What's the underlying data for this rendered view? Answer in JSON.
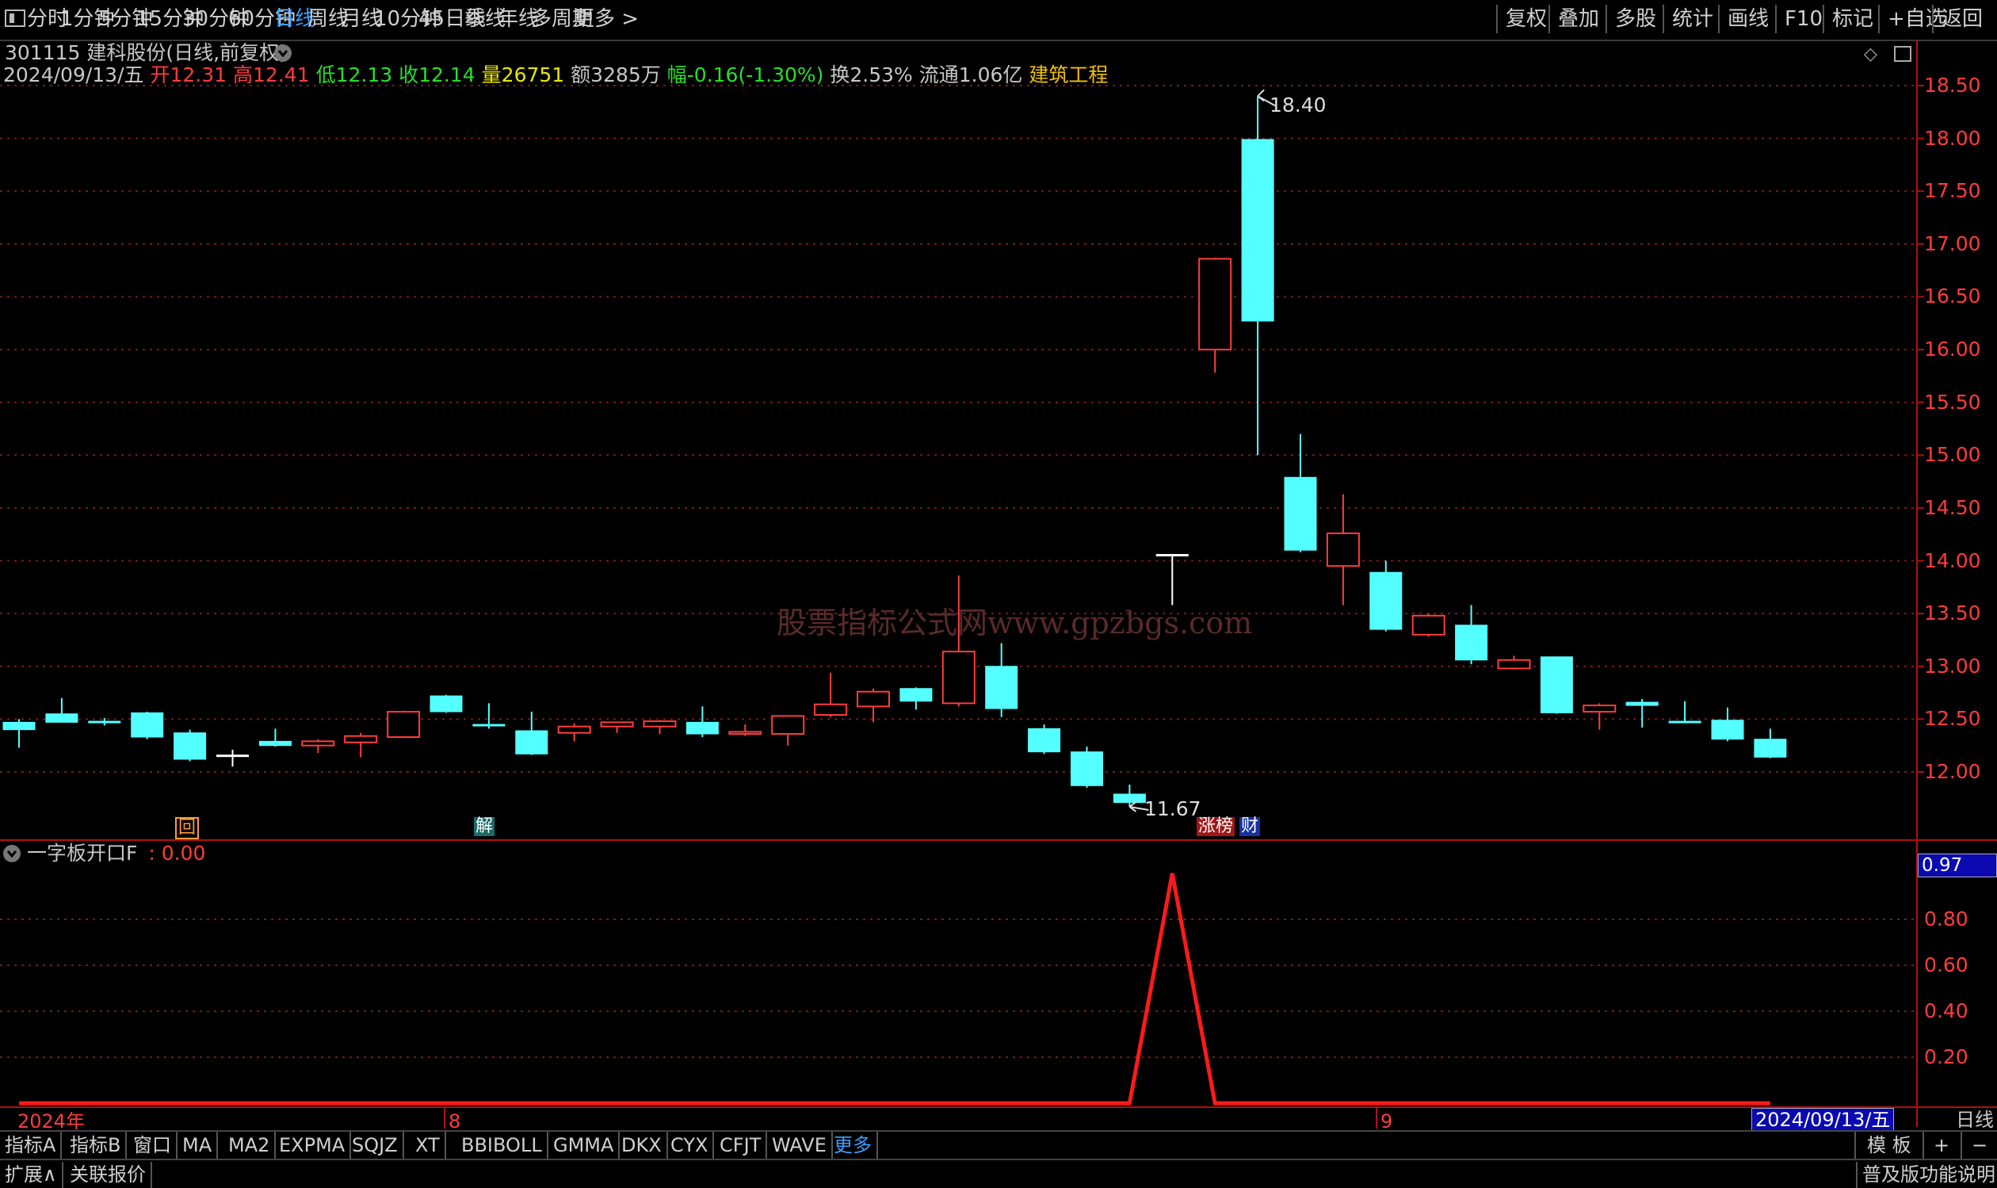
{
  "toolbar": {
    "periods": [
      {
        "label": "分时",
        "active": false
      },
      {
        "label": "1分钟",
        "active": false
      },
      {
        "label": "5分钟",
        "active": false
      },
      {
        "label": "15分钟",
        "active": false
      },
      {
        "label": "30分钟",
        "active": false
      },
      {
        "label": "60分钟",
        "active": false
      },
      {
        "label": "日线",
        "active": true
      },
      {
        "label": "周线",
        "active": false
      },
      {
        "label": "月线",
        "active": false
      },
      {
        "label": "10分钟",
        "active": false
      },
      {
        "label": "45日线",
        "active": false
      },
      {
        "label": "季线",
        "active": false
      },
      {
        "label": "年线",
        "active": false
      },
      {
        "label": "多周期",
        "active": false
      },
      {
        "label": "更多 >",
        "active": false
      }
    ],
    "right_buttons": [
      "复权",
      "叠加",
      "多股",
      "统计",
      "画线",
      "F10",
      "标记",
      "+自选",
      "返回"
    ]
  },
  "stock": {
    "title": "301115 建科股份(日线,前复权)",
    "date": "2024/09/13/五",
    "open_label": "开",
    "open": "12.31",
    "high_label": "高",
    "high": "12.41",
    "low_label": "低",
    "low": "12.13",
    "close_label": "收",
    "close": "12.14",
    "volume_label": "量",
    "volume": "26751",
    "amount_label": "额",
    "amount": "3285万",
    "change_label": "幅",
    "change": "-0.16(-1.30%)",
    "turnover": "换2.53%",
    "float": "流通1.06亿",
    "sector": "建筑工程"
  },
  "price_axis": [
    "18.50",
    "18.00",
    "17.50",
    "17.00",
    "16.50",
    "16.00",
    "15.50",
    "15.00",
    "14.50",
    "14.00",
    "13.50",
    "13.00",
    "12.50",
    "12.00"
  ],
  "indicator": {
    "name": "一字板开口F",
    "value": ": 0.00",
    "axis": [
      "0.80",
      "0.60",
      "0.40",
      "0.20"
    ],
    "current": "0.97"
  },
  "annotations": {
    "high_label": "18.40",
    "low_label": "11.67",
    "marker_hui": "回",
    "marker_jie": "解",
    "marker_zhangbang": "涨榜",
    "marker_cai": "财"
  },
  "date_axis": {
    "start": "2024年",
    "m8": "8",
    "m9": "9",
    "current_date": "2024/09/13/五",
    "period": "日线"
  },
  "watermark": "股票指标公式网www.gpzbgs.com",
  "bottom_tabs": [
    {
      "label": "指标A",
      "active": false
    },
    {
      "label": "指标B",
      "active": false
    },
    {
      "label": "窗口",
      "active": false
    },
    {
      "label": "MA",
      "active": false
    },
    {
      "label": "MA2",
      "active": false
    },
    {
      "label": "EXPMA",
      "active": false
    },
    {
      "label": "SQJZ",
      "active": false
    },
    {
      "label": "XT",
      "active": false
    },
    {
      "label": "BBIBOLL",
      "active": false
    },
    {
      "label": "GMMA",
      "active": false
    },
    {
      "label": "DKX",
      "active": false
    },
    {
      "label": "CYX",
      "active": false
    },
    {
      "label": "CFJT",
      "active": false
    },
    {
      "label": "WAVE",
      "active": false
    },
    {
      "label": "更多",
      "active": true
    }
  ],
  "bottom_right": {
    "template": "模 板",
    "plus": "+",
    "minus": "−"
  },
  "status": {
    "expand": "扩展∧",
    "related": "关联报价",
    "edition": "普及版功能说明"
  },
  "colors": {
    "up": "#ff3c3c",
    "down": "#54ffff",
    "doji": "#ffffff",
    "grid": "#7a1a1a",
    "indicator_line": "#ff1a1a"
  },
  "chart_data": {
    "type": "candlestick",
    "symbol": "301115 建科股份",
    "y_range": [
      11.5,
      18.6
    ],
    "candles": [
      {
        "o": 12.47,
        "h": 12.5,
        "l": 12.23,
        "c": 12.4
      },
      {
        "o": 12.55,
        "h": 12.7,
        "l": 12.48,
        "c": 12.47
      },
      {
        "o": 12.48,
        "h": 12.51,
        "l": 12.44,
        "c": 12.47
      },
      {
        "o": 12.56,
        "h": 12.57,
        "l": 12.31,
        "c": 12.33
      },
      {
        "o": 12.37,
        "h": 12.4,
        "l": 12.1,
        "c": 12.12
      },
      {
        "o": 12.16,
        "h": 12.21,
        "l": 12.05,
        "c": 12.16
      },
      {
        "o": 12.29,
        "h": 12.41,
        "l": 12.24,
        "c": 12.25
      },
      {
        "o": 12.25,
        "h": 12.31,
        "l": 12.18,
        "c": 12.29
      },
      {
        "o": 12.28,
        "h": 12.37,
        "l": 12.14,
        "c": 12.34
      },
      {
        "o": 12.33,
        "h": 12.58,
        "l": 12.32,
        "c": 12.57
      },
      {
        "o": 12.72,
        "h": 12.73,
        "l": 12.56,
        "c": 12.57
      },
      {
        "o": 12.45,
        "h": 12.65,
        "l": 12.41,
        "c": 12.44
      },
      {
        "o": 12.39,
        "h": 12.57,
        "l": 12.16,
        "c": 12.17
      },
      {
        "o": 12.37,
        "h": 12.46,
        "l": 12.29,
        "c": 12.43
      },
      {
        "o": 12.43,
        "h": 12.47,
        "l": 12.37,
        "c": 12.47
      },
      {
        "o": 12.43,
        "h": 12.49,
        "l": 12.36,
        "c": 12.48
      },
      {
        "o": 12.47,
        "h": 12.62,
        "l": 12.33,
        "c": 12.36
      },
      {
        "o": 12.36,
        "h": 12.45,
        "l": 12.34,
        "c": 12.38
      },
      {
        "o": 12.36,
        "h": 12.53,
        "l": 12.25,
        "c": 12.53
      },
      {
        "o": 12.54,
        "h": 12.94,
        "l": 12.52,
        "c": 12.64
      },
      {
        "o": 12.62,
        "h": 12.79,
        "l": 12.47,
        "c": 12.76
      },
      {
        "o": 12.79,
        "h": 12.8,
        "l": 12.59,
        "c": 12.67
      },
      {
        "o": 12.65,
        "h": 13.86,
        "l": 12.62,
        "c": 13.14
      },
      {
        "o": 13.0,
        "h": 13.22,
        "l": 12.52,
        "c": 12.6
      },
      {
        "o": 12.41,
        "h": 12.45,
        "l": 12.17,
        "c": 12.19
      },
      {
        "o": 12.19,
        "h": 12.24,
        "l": 11.85,
        "c": 11.87
      },
      {
        "o": 11.79,
        "h": 11.88,
        "l": 11.67,
        "c": 11.71
      },
      {
        "o": 14.06,
        "h": 14.06,
        "l": 13.58,
        "c": 14.06
      },
      {
        "o": 16.0,
        "h": 16.87,
        "l": 15.78,
        "c": 16.86
      },
      {
        "o": 17.99,
        "h": 18.4,
        "l": 15.0,
        "c": 16.27
      },
      {
        "o": 14.79,
        "h": 15.2,
        "l": 14.08,
        "c": 14.1
      },
      {
        "o": 13.95,
        "h": 14.63,
        "l": 13.58,
        "c": 14.26
      },
      {
        "o": 13.89,
        "h": 14.0,
        "l": 13.33,
        "c": 13.35
      },
      {
        "o": 13.3,
        "h": 13.5,
        "l": 13.28,
        "c": 13.48
      },
      {
        "o": 13.39,
        "h": 13.58,
        "l": 13.02,
        "c": 13.06
      },
      {
        "o": 12.98,
        "h": 13.1,
        "l": 12.97,
        "c": 13.06
      },
      {
        "o": 13.09,
        "h": 13.09,
        "l": 12.55,
        "c": 12.56
      },
      {
        "o": 12.57,
        "h": 12.65,
        "l": 12.4,
        "c": 12.63
      },
      {
        "o": 12.66,
        "h": 12.69,
        "l": 12.42,
        "c": 12.63
      },
      {
        "o": 12.48,
        "h": 12.67,
        "l": 12.47,
        "c": 12.47
      },
      {
        "o": 12.49,
        "h": 12.61,
        "l": 12.29,
        "c": 12.31
      },
      {
        "o": 12.31,
        "h": 12.41,
        "l": 12.13,
        "c": 12.14
      }
    ],
    "indicator_series": {
      "name": "一字板开口F",
      "y_range": [
        0,
        1.0
      ],
      "values": [
        0,
        0,
        0,
        0,
        0,
        0,
        0,
        0,
        0,
        0,
        0,
        0,
        0,
        0,
        0,
        0,
        0,
        0,
        0,
        0,
        0,
        0,
        0,
        0,
        0,
        0,
        0,
        1,
        0,
        0,
        0,
        0,
        0,
        0,
        0,
        0,
        0,
        0,
        0,
        0,
        0,
        0
      ]
    }
  }
}
